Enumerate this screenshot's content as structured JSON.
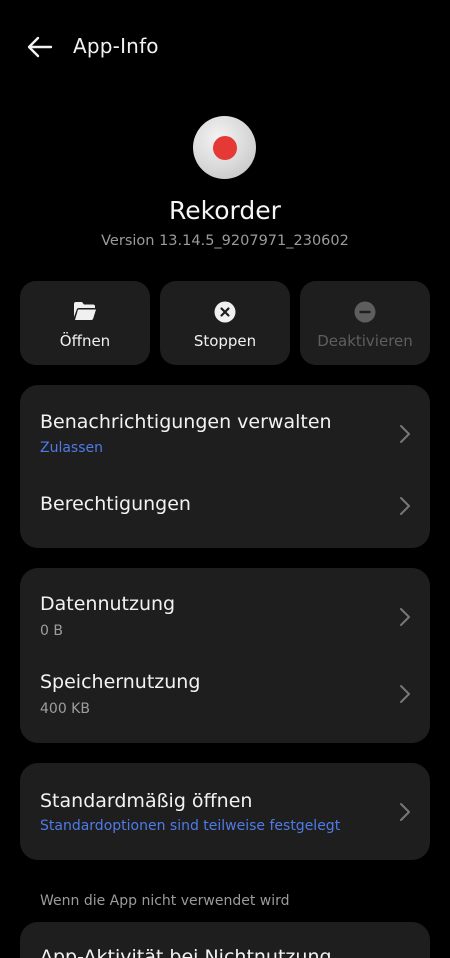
{
  "header": {
    "title": "App-Info"
  },
  "app": {
    "name": "Rekorder",
    "version": "Version 13.14.5_9207971_230602",
    "icon_color": "#e53935"
  },
  "actions": [
    {
      "label": "Öffnen",
      "icon": "folder-icon",
      "enabled": true
    },
    {
      "label": "Stoppen",
      "icon": "stop-x-icon",
      "enabled": true
    },
    {
      "label": "Deaktivieren",
      "icon": "disable-minus-icon",
      "enabled": false
    }
  ],
  "card1": {
    "notifications": {
      "title": "Benachrichtigungen verwalten",
      "subtitle": "Zulassen"
    },
    "permissions": {
      "title": "Berechtigungen"
    }
  },
  "card2": {
    "data_usage": {
      "title": "Datennutzung",
      "subtitle": "0 B"
    },
    "storage_usage": {
      "title": "Speichernutzung",
      "subtitle": "400 KB"
    }
  },
  "card3": {
    "open_default": {
      "title": "Standardmäßig öffnen",
      "subtitle": "Standardoptionen sind teilweise festgelegt"
    }
  },
  "unused_section": {
    "label": "Wenn die App nicht verwendet wird",
    "item_title": "App-Aktivität bei Nichtnutzung"
  },
  "colors": {
    "background": "#000000",
    "card": "#1e1e1e",
    "link": "#4f7ae8"
  }
}
